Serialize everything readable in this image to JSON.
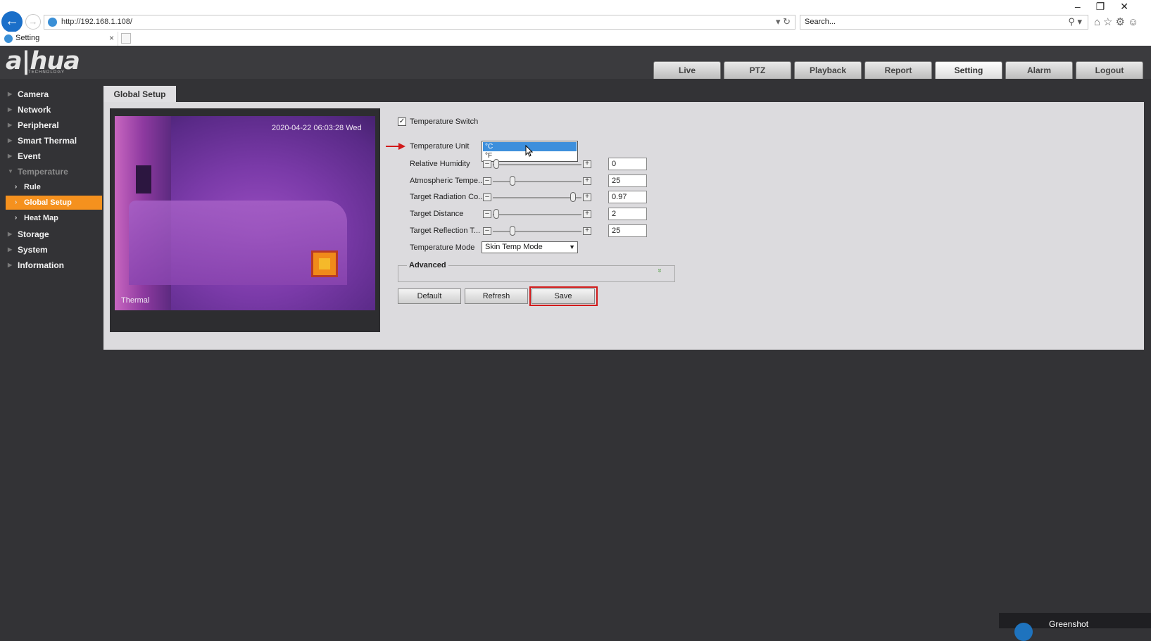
{
  "browser": {
    "url": "http://192.168.1.108/",
    "search_placeholder": "Search...",
    "tab_title": "Setting",
    "tab_close": "×",
    "back_glyph": "←",
    "fwd_glyph": "→",
    "addr_ctrls": "▾ ↻",
    "search_ctrls": "⚲ ▾",
    "right_icons": "⌂☆⚙☺",
    "window_controls": "–❐✕"
  },
  "app": {
    "logo": "a|hua",
    "logo_sub": "TECHNOLOGY",
    "nav": [
      "Live",
      "PTZ",
      "Playback",
      "Report",
      "Setting",
      "Alarm",
      "Logout"
    ]
  },
  "sidebar": {
    "items": [
      "Camera",
      "Network",
      "Peripheral",
      "Smart Thermal",
      "Event",
      "Temperature",
      "Storage",
      "System",
      "Information"
    ],
    "sub_items": [
      "Rule",
      "Global Setup",
      "Heat Map"
    ],
    "arrow_collapsed": "▶",
    "arrow_expanded": "▼",
    "sub_arrow": "›"
  },
  "content": {
    "tab": "Global Setup",
    "preview": {
      "timestamp": "2020-04-22 06:03:28 Wed",
      "osd_label": "Thermal"
    },
    "form": {
      "temperature_switch": {
        "label": "Temperature Switch",
        "checked": true,
        "mark": "✓"
      },
      "temperature_unit": {
        "label": "Temperature Unit",
        "options": [
          "°C",
          "°F"
        ],
        "selected": "°C"
      },
      "relative_humidity": {
        "label": "Relative Humidity",
        "value": "0"
      },
      "atmospheric_temp": {
        "label": "Atmospheric Tempe...",
        "value": "25"
      },
      "target_radiation": {
        "label": "Target Radiation Co...",
        "value": "0.97"
      },
      "target_distance": {
        "label": "Target Distance",
        "value": "2"
      },
      "target_reflection": {
        "label": "Target Reflection T...",
        "value": "25"
      },
      "temperature_mode": {
        "label": "Temperature Mode",
        "value": "Skin Temp Mode",
        "arrow": "▼"
      },
      "advanced": {
        "label": "Advanced",
        "toggle": "»"
      },
      "slider_minus": "–",
      "slider_plus": "+"
    },
    "buttons": {
      "default": "Default",
      "refresh": "Refresh",
      "save": "Save"
    }
  },
  "greenshot": {
    "label": "Greenshot"
  },
  "colors": {
    "accent_orange": "#f5911e",
    "highlight_red": "#d11a1a",
    "background_dark": "#333336"
  }
}
